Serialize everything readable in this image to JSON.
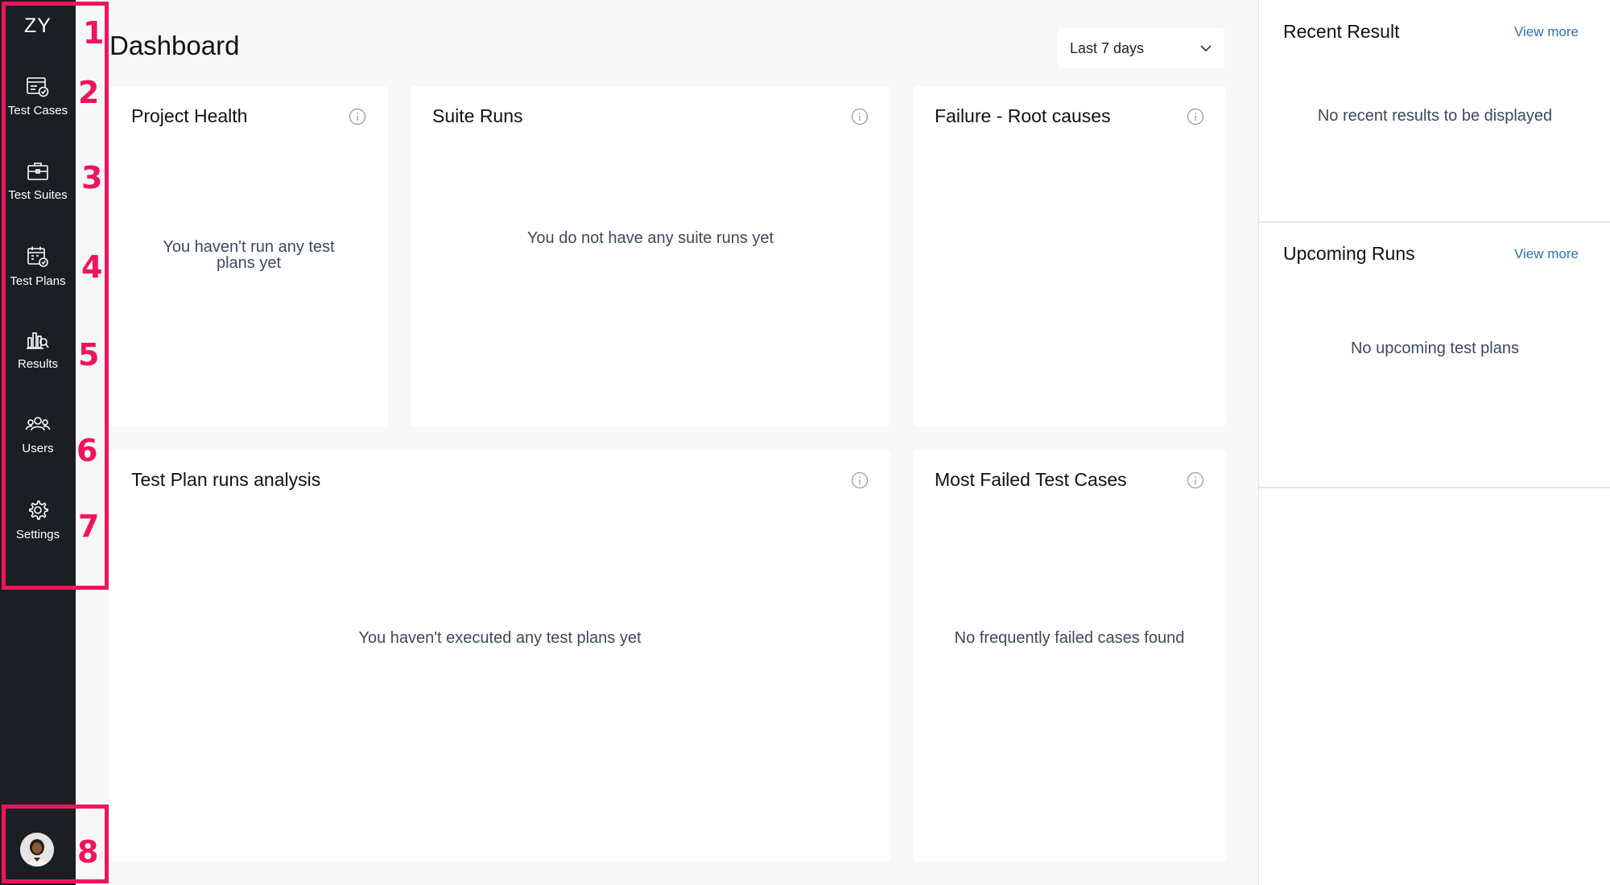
{
  "sidebar": {
    "logo": "ZY",
    "items": [
      {
        "label": "Test Cases"
      },
      {
        "label": "Test Suites"
      },
      {
        "label": "Test Plans"
      },
      {
        "label": "Results"
      },
      {
        "label": "Users"
      },
      {
        "label": "Settings"
      }
    ]
  },
  "annotations": [
    "1",
    "2",
    "3",
    "4",
    "5",
    "6",
    "7",
    "8"
  ],
  "header": {
    "title": "Dashboard",
    "range_select": "Last 7 days"
  },
  "cards": {
    "project_health": {
      "title": "Project Health",
      "empty": "You haven't run any test plans yet"
    },
    "suite_runs": {
      "title": "Suite Runs",
      "empty": "You do not have any suite runs yet"
    },
    "failure_root": {
      "title": "Failure - Root causes"
    },
    "test_plan_runs": {
      "title": "Test Plan runs analysis",
      "empty": "You haven't executed any test plans yet"
    },
    "most_failed": {
      "title": "Most Failed Test Cases",
      "empty": "No frequently failed cases found"
    }
  },
  "right_panel": {
    "recent": {
      "title": "Recent Result",
      "link": "View more",
      "empty": "No recent results to be displayed"
    },
    "upcoming": {
      "title": "Upcoming Runs",
      "link": "View more",
      "empty": "No upcoming test plans"
    }
  },
  "colors": {
    "sidebar_bg": "#1b1f24",
    "annotation": "#f0145a",
    "link": "#2f6fb4",
    "page_bg": "#f7f7f8"
  }
}
